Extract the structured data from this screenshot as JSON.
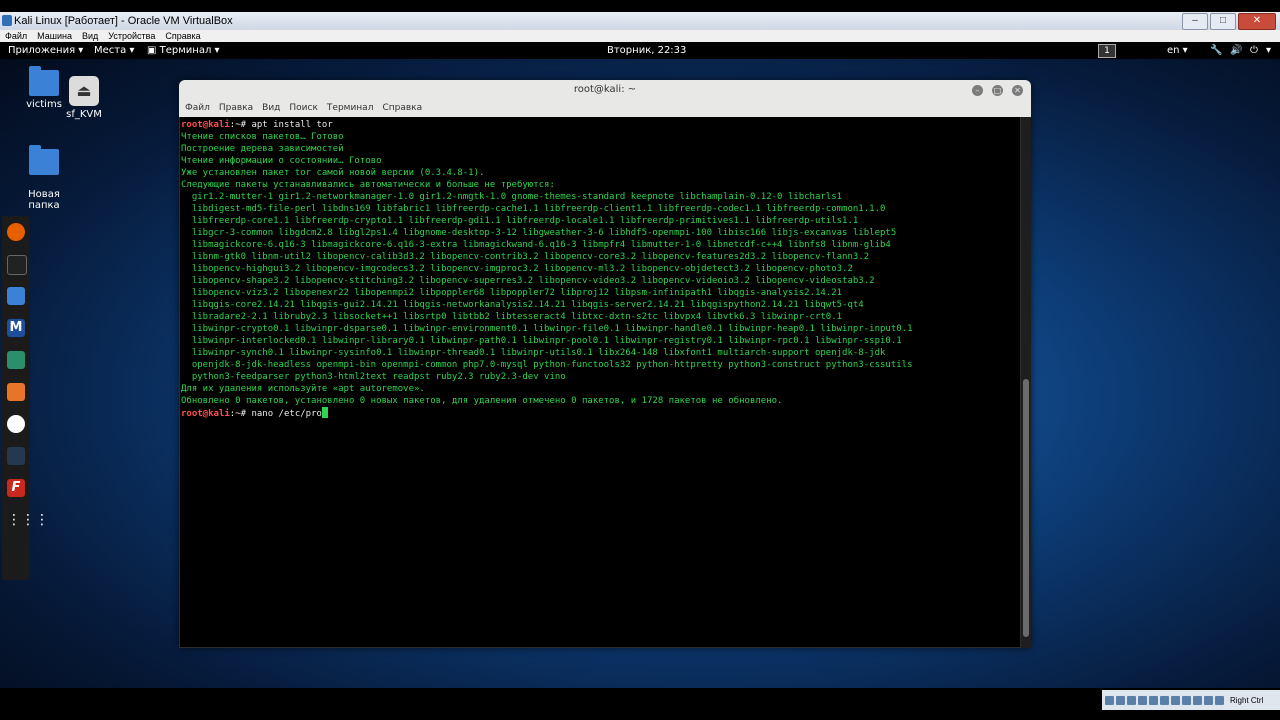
{
  "host": {
    "title": "Kali Linux [Работает] - Oracle VM VirtualBox",
    "menu": [
      "Файл",
      "Машина",
      "Вид",
      "Устройства",
      "Справка"
    ],
    "status_text": "Right Ctrl"
  },
  "gnome": {
    "apps_label": "Приложения ▾",
    "places_label": "Места ▾",
    "terminal_label": "Терминал ▾",
    "clock": "Вторник, 22:33",
    "workspace": "1",
    "lang": "en ▾"
  },
  "desktop": {
    "icons": [
      {
        "label": "victims"
      },
      {
        "label": "sf_KVM"
      },
      {
        "label": "Новая\nпапка"
      }
    ]
  },
  "terminal": {
    "title": "root@kali: ~",
    "menu": [
      "Файл",
      "Правка",
      "Вид",
      "Поиск",
      "Терминал",
      "Справка"
    ],
    "prompt": "root@kali",
    "prompt_sep": ":~# ",
    "command1": "apt install tor",
    "output": [
      "Чтение списков пакетов… Готово",
      "Построение дерева зависимостей",
      "Чтение информации о состоянии… Готово",
      "Уже установлен пакет tor самой новой версии (0.3.4.8-1).",
      "Следующие пакеты устанавливались автоматически и больше не требуются:",
      "  gir1.2-mutter-1 gir1.2-networkmanager-1.0 gir1.2-nmgtk-1.0 gnome-themes-standard keepnote libchamplain-0.12-0 libcharls1",
      "  libdigest-md5-file-perl libdns169 libfabric1 libfreerdp-cache1.1 libfreerdp-client1.1 libfreerdp-codec1.1 libfreerdp-common1.1.0",
      "  libfreerdp-core1.1 libfreerdp-crypto1.1 libfreerdp-gdi1.1 libfreerdp-locale1.1 libfreerdp-primitives1.1 libfreerdp-utils1.1",
      "  libgcr-3-common libgdcm2.8 libgl2ps1.4 libgnome-desktop-3-12 libgweather-3-6 libhdf5-openmpi-100 libisc166 libjs-excanvas liblept5",
      "  libmagickcore-6.q16-3 libmagickcore-6.q16-3-extra libmagickwand-6.q16-3 libmpfr4 libmutter-1-0 libnetcdf-c++4 libnfs8 libnm-glib4",
      "  libnm-gtk0 libnm-util2 libopencv-calib3d3.2 libopencv-contrib3.2 libopencv-core3.2 libopencv-features2d3.2 libopencv-flann3.2",
      "  libopencv-highgui3.2 libopencv-imgcodecs3.2 libopencv-imgproc3.2 libopencv-ml3.2 libopencv-objdetect3.2 libopencv-photo3.2",
      "  libopencv-shape3.2 libopencv-stitching3.2 libopencv-superres3.2 libopencv-video3.2 libopencv-videoio3.2 libopencv-videostab3.2",
      "  libopencv-viz3.2 libopenexr22 libopenmpi2 libpoppler68 libpoppler72 libproj12 libpsm-infinipath1 libqgis-analysis2.14.21",
      "  libqgis-core2.14.21 libqgis-gui2.14.21 libqgis-networkanalysis2.14.21 libqgis-server2.14.21 libqgispython2.14.21 libqwt5-qt4",
      "  libradare2-2.1 libruby2.3 libsocket++1 libsrtp0 libtbb2 libtesseract4 libtxc-dxtn-s2tc libvpx4 libvtk6.3 libwinpr-crt0.1",
      "  libwinpr-crypto0.1 libwinpr-dsparse0.1 libwinpr-environment0.1 libwinpr-file0.1 libwinpr-handle0.1 libwinpr-heap0.1 libwinpr-input0.1",
      "  libwinpr-interlocked0.1 libwinpr-library0.1 libwinpr-path0.1 libwinpr-pool0.1 libwinpr-registry0.1 libwinpr-rpc0.1 libwinpr-sspi0.1",
      "  libwinpr-synch0.1 libwinpr-sysinfo0.1 libwinpr-thread0.1 libwinpr-utils0.1 libx264-148 libxfont1 multiarch-support openjdk-8-jdk",
      "  openjdk-8-jdk-headless openmpi-bin openmpi-common php7.0-mysql python-functools32 python-httpretty python3-construct python3-cssutils",
      "  python3-feedparser python3-html2text readpst ruby2.3 ruby2.3-dev vino",
      "Для их удаления используйте «apt autoremove».",
      "Обновлено 0 пакетов, установлено 0 новых пакетов, для удаления отмечено 0 пакетов, и 1728 пакетов не обновлено."
    ],
    "command2": "nano /etc/pro"
  }
}
